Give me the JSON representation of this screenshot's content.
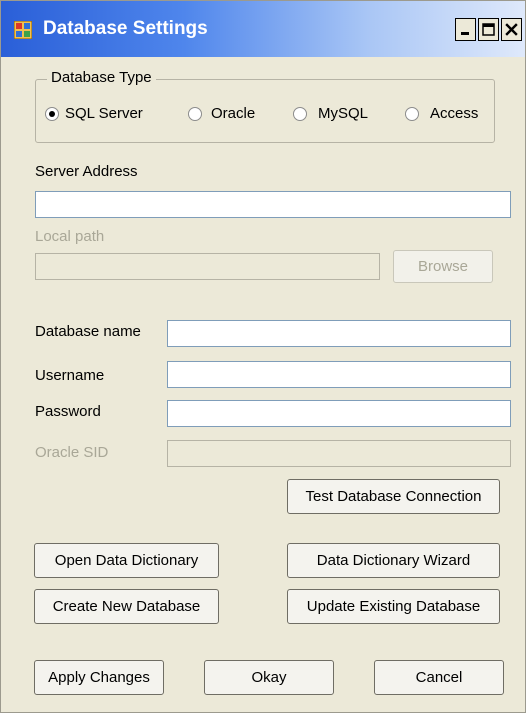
{
  "window": {
    "title": "Database Settings",
    "icon": "database-app-icon"
  },
  "database_type": {
    "group_label": "Database Type",
    "options": [
      "SQL Server",
      "Oracle",
      "MySQL",
      "Access"
    ],
    "selected": "SQL Server"
  },
  "server_address": {
    "label": "Server Address",
    "value": ""
  },
  "local_path": {
    "label": "Local path",
    "value": "",
    "enabled": false,
    "browse_label": "Browse"
  },
  "fields": {
    "database_name": {
      "label": "Database name",
      "value": ""
    },
    "username": {
      "label": "Username",
      "value": ""
    },
    "password": {
      "label": "Password",
      "value": ""
    },
    "oracle_sid": {
      "label": "Oracle SID",
      "value": "",
      "enabled": false
    }
  },
  "buttons": {
    "test_connection": "Test Database Connection",
    "open_dictionary": "Open Data Dictionary",
    "dictionary_wizard": "Data Dictionary Wizard",
    "create_database": "Create New Database",
    "update_database": "Update Existing Database",
    "apply": "Apply Changes",
    "okay": "Okay",
    "cancel": "Cancel"
  },
  "colors": {
    "titlebar_start": "#2a5fd8",
    "titlebar_end": "#dfe9fb",
    "window_background": "#ece9d8",
    "disabled_text": "#a9a797"
  }
}
